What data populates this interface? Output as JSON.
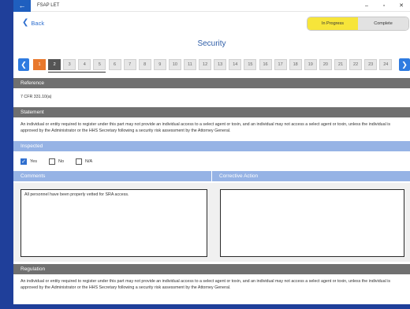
{
  "window": {
    "title": "FSAP LET",
    "back_glyph": "←",
    "minimize": "–",
    "maximize": "▫",
    "close": "✕"
  },
  "nav": {
    "back_label": "Back",
    "back_chevron": "❮"
  },
  "status": {
    "in_progress": "In Progress",
    "complete": "Complete",
    "active": "In Progress",
    "active_color": "#f7e53a"
  },
  "page": {
    "title": "Security"
  },
  "pager": {
    "prev": "❮",
    "next": "❯",
    "pages": [
      "1",
      "2",
      "3",
      "4",
      "5",
      "6",
      "7",
      "8",
      "9",
      "10",
      "11",
      "12",
      "13",
      "14",
      "15",
      "16",
      "17",
      "18",
      "19",
      "20",
      "21",
      "22",
      "23",
      "24"
    ],
    "current": "1",
    "selected": "2"
  },
  "reference": {
    "header": "Reference",
    "value": "7 CFR 331.10(a)"
  },
  "statement": {
    "header": "Statement",
    "text": "An individual or entity required to register under this part may not provide an individual access to a select agent or toxin, and an individual may not access a select agent or toxin, unless the individual is approved by the Administrator or the HHS Secretary following a security risk assessment by the Attorney General."
  },
  "inspected": {
    "header": "Inspected",
    "options": [
      {
        "label": "Yes",
        "checked": true
      },
      {
        "label": "No",
        "checked": false
      },
      {
        "label": "N/A",
        "checked": false
      }
    ],
    "check_glyph": "✓"
  },
  "comments": {
    "header": "Comments",
    "value": "All personnel have been properly vetted for SRA access."
  },
  "corrective": {
    "header": "Corrective Action",
    "value": ""
  },
  "regulation": {
    "header": "Regulation",
    "text": "An individual or entity required to register under this part may not provide an individual access to a select agent or toxin, and an individual may not access a select agent or toxin, unless the individual is approved by the Administrator or the HHS Secretary following a security risk assessment by the Attorney General."
  },
  "colors": {
    "accent": "#2f7be0",
    "section_gray": "#707070",
    "section_blue": "#96b3e5",
    "current_page": "#e8782c"
  }
}
